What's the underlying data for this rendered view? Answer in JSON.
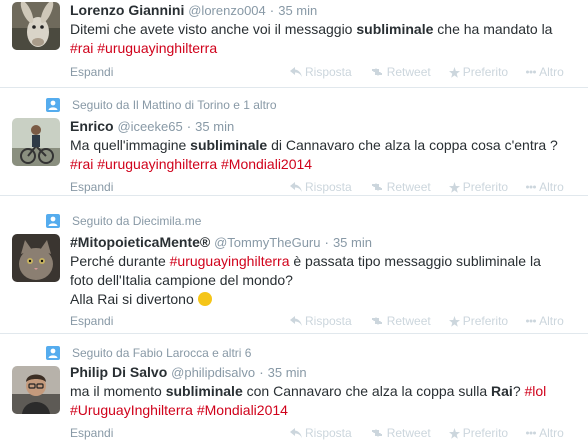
{
  "tweets": [
    {
      "fullname": "Lorenzo Giannini",
      "username": "@lorenzo004",
      "time": "35 min",
      "text": [
        "Ditemi che avete visto anche voi il messaggio ",
        "subliminale",
        " che ha mandato la ",
        "#rai",
        " ",
        "#uruguayinghilterra"
      ],
      "expand": "Espandi"
    },
    {
      "social_context": "Seguito da Il Mattino di Torino e 1 altro",
      "fullname": "Enrico",
      "username": "@iceeke65",
      "time": "35 min",
      "text": [
        "Ma quell'immagine ",
        "subliminale",
        " di Cannavaro che alza la coppa cosa c'entra ?",
        "#rai",
        " ",
        "#uruguayinghilterra",
        " ",
        "#Mondiali2014"
      ],
      "expand": "Espandi"
    },
    {
      "social_context": "Seguito da Diecimila.me",
      "fullname": "#MitopoieticaMente®",
      "username": "@TommyTheGuru",
      "time": "35 min",
      "text": [
        "Perché durante ",
        "#uruguayinghilterra",
        " è passata tipo messaggio subliminale la foto dell'Italia campione del mondo?",
        "Alla Rai si divertono"
      ],
      "expand": "Espandi"
    },
    {
      "social_context": "Seguito da Fabio Larocca e altri 6",
      "fullname": "Philip Di Salvo",
      "username": "@philipdisalvo",
      "time": "35 min",
      "text": [
        "ma il momento ",
        "subliminale",
        " con Cannavaro che alza la coppa sulla ",
        "Rai",
        "? ",
        "#lol",
        "#UruguayInghilterra",
        " ",
        "#Mondiali2014"
      ],
      "expand": "Espandi"
    }
  ],
  "actions": {
    "reply": "Risposta",
    "retweet": "Retweet",
    "favorite": "Preferito",
    "more": "Altro"
  },
  "colors": {
    "hashtag": "#d0021b",
    "muted": "#8899a6",
    "action": "#ccd6dd"
  }
}
